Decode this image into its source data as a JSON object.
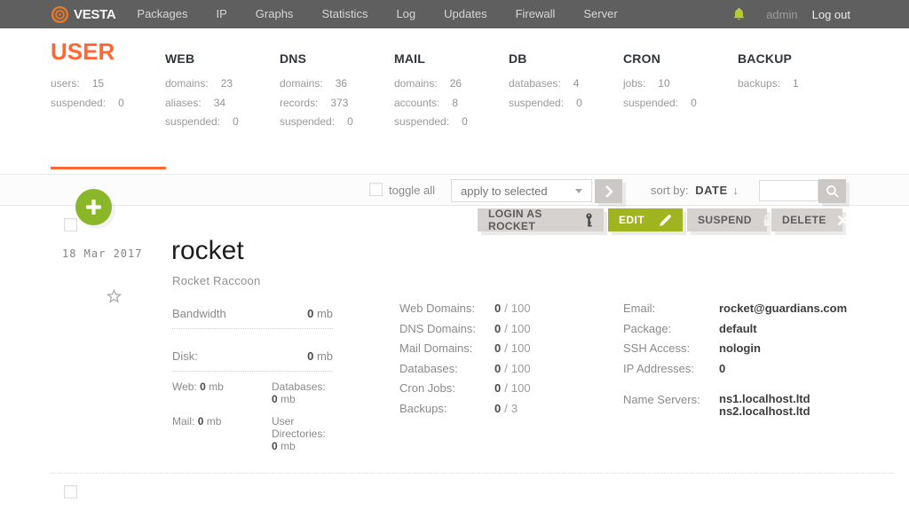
{
  "colors": {
    "accent_orange": "#ff6733",
    "navbar_bg": "#5f5f5f",
    "action_green": "#9fb41f",
    "add_button_green": "#8ab629",
    "bell_green": "#b9cb32",
    "button_gray": "#d5d2cf"
  },
  "navbar": {
    "brand": "VESTA",
    "items": [
      "Packages",
      "IP",
      "Graphs",
      "Statistics",
      "Log",
      "Updates",
      "Firewall",
      "Server"
    ],
    "username": "admin",
    "logout": "Log out"
  },
  "stats": {
    "columns": [
      {
        "title": "USER",
        "rows": [
          {
            "label": "users:",
            "value": "15"
          },
          {
            "label": "suspended:",
            "value": "0"
          }
        ]
      },
      {
        "title": "WEB",
        "rows": [
          {
            "label": "domains:",
            "value": "23"
          },
          {
            "label": "aliases:",
            "value": "34"
          },
          {
            "label": "suspended:",
            "value": "0"
          }
        ]
      },
      {
        "title": "DNS",
        "rows": [
          {
            "label": "domains:",
            "value": "36"
          },
          {
            "label": "records:",
            "value": "373"
          },
          {
            "label": "suspended:",
            "value": "0"
          }
        ]
      },
      {
        "title": "MAIL",
        "rows": [
          {
            "label": "domains:",
            "value": "26"
          },
          {
            "label": "accounts:",
            "value": "8"
          },
          {
            "label": "suspended:",
            "value": "0"
          }
        ]
      },
      {
        "title": "DB",
        "rows": [
          {
            "label": "databases:",
            "value": "4"
          },
          {
            "label": "suspended:",
            "value": "0"
          }
        ]
      },
      {
        "title": "CRON",
        "rows": [
          {
            "label": "jobs:",
            "value": "10"
          },
          {
            "label": "suspended:",
            "value": "0"
          }
        ]
      },
      {
        "title": "BACKUP",
        "rows": [
          {
            "label": "backups:",
            "value": "1"
          }
        ]
      }
    ]
  },
  "toolbar": {
    "toggle_all": "toggle all",
    "bulk_action": "apply to selected",
    "sort_label": "sort by:",
    "sort_value": "DATE",
    "sort_direction": "↓",
    "search_value": ""
  },
  "user": {
    "date": "18 Mar 2017",
    "login": "rocket",
    "full_name": "Rocket Raccoon",
    "actions": {
      "login_as": "LOGIN AS ROCKET",
      "edit": "EDIT",
      "suspend": "SUSPEND",
      "delete": "DELETE"
    },
    "usage": {
      "bandwidth_label": "Bandwidth",
      "bandwidth_value": "0",
      "bandwidth_unit": "mb",
      "disk_label": "Disk:",
      "disk_value": "0",
      "disk_unit": "mb",
      "breakdown": [
        {
          "label": "Web:",
          "value": "0",
          "unit": "mb"
        },
        {
          "label": "Databases:",
          "value": "0",
          "unit": "mb"
        },
        {
          "label": "Mail:",
          "value": "0",
          "unit": "mb"
        },
        {
          "label": "User Directories:",
          "value": "0",
          "unit": "mb"
        }
      ]
    },
    "limits": {
      "separator": "/",
      "rows": [
        {
          "label": "Web Domains:",
          "used": "0",
          "max": "100"
        },
        {
          "label": "DNS Domains:",
          "used": "0",
          "max": "100"
        },
        {
          "label": "Mail Domains:",
          "used": "0",
          "max": "100"
        },
        {
          "label": "Databases:",
          "used": "0",
          "max": "100"
        },
        {
          "label": "Cron Jobs:",
          "used": "0",
          "max": "100"
        },
        {
          "label": "Backups:",
          "used": "0",
          "max": "3"
        }
      ]
    },
    "info": {
      "email_label": "Email:",
      "email": "rocket@guardians.com",
      "package_label": "Package:",
      "package": "default",
      "ssh_label": "SSH Access:",
      "ssh": "nologin",
      "ip_label": "IP Addresses:",
      "ip": "0",
      "ns_label": "Name Servers:",
      "ns1": "ns1.localhost.ltd",
      "ns2": "ns2.localhost.ltd"
    }
  }
}
